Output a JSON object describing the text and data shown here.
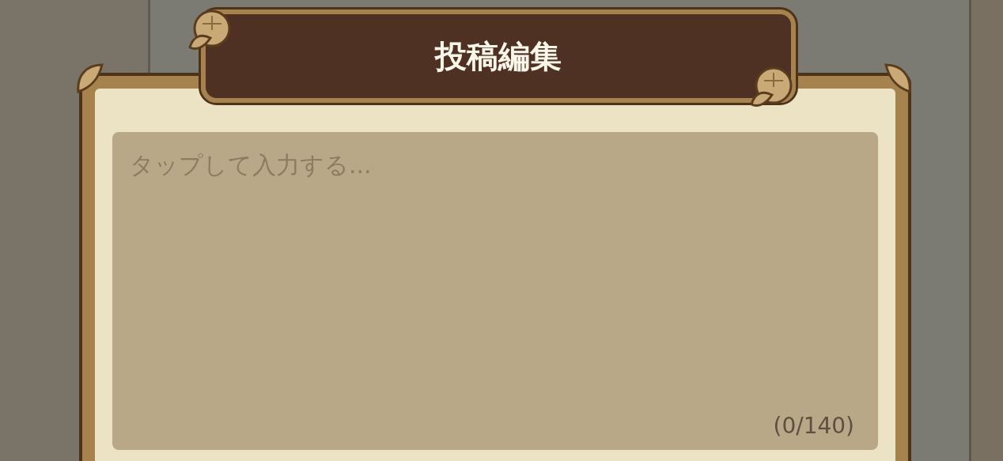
{
  "dialog": {
    "title": "投稿編集",
    "post_field": {
      "placeholder": "タップして入力する...",
      "counter": "(0/140)"
    }
  }
}
